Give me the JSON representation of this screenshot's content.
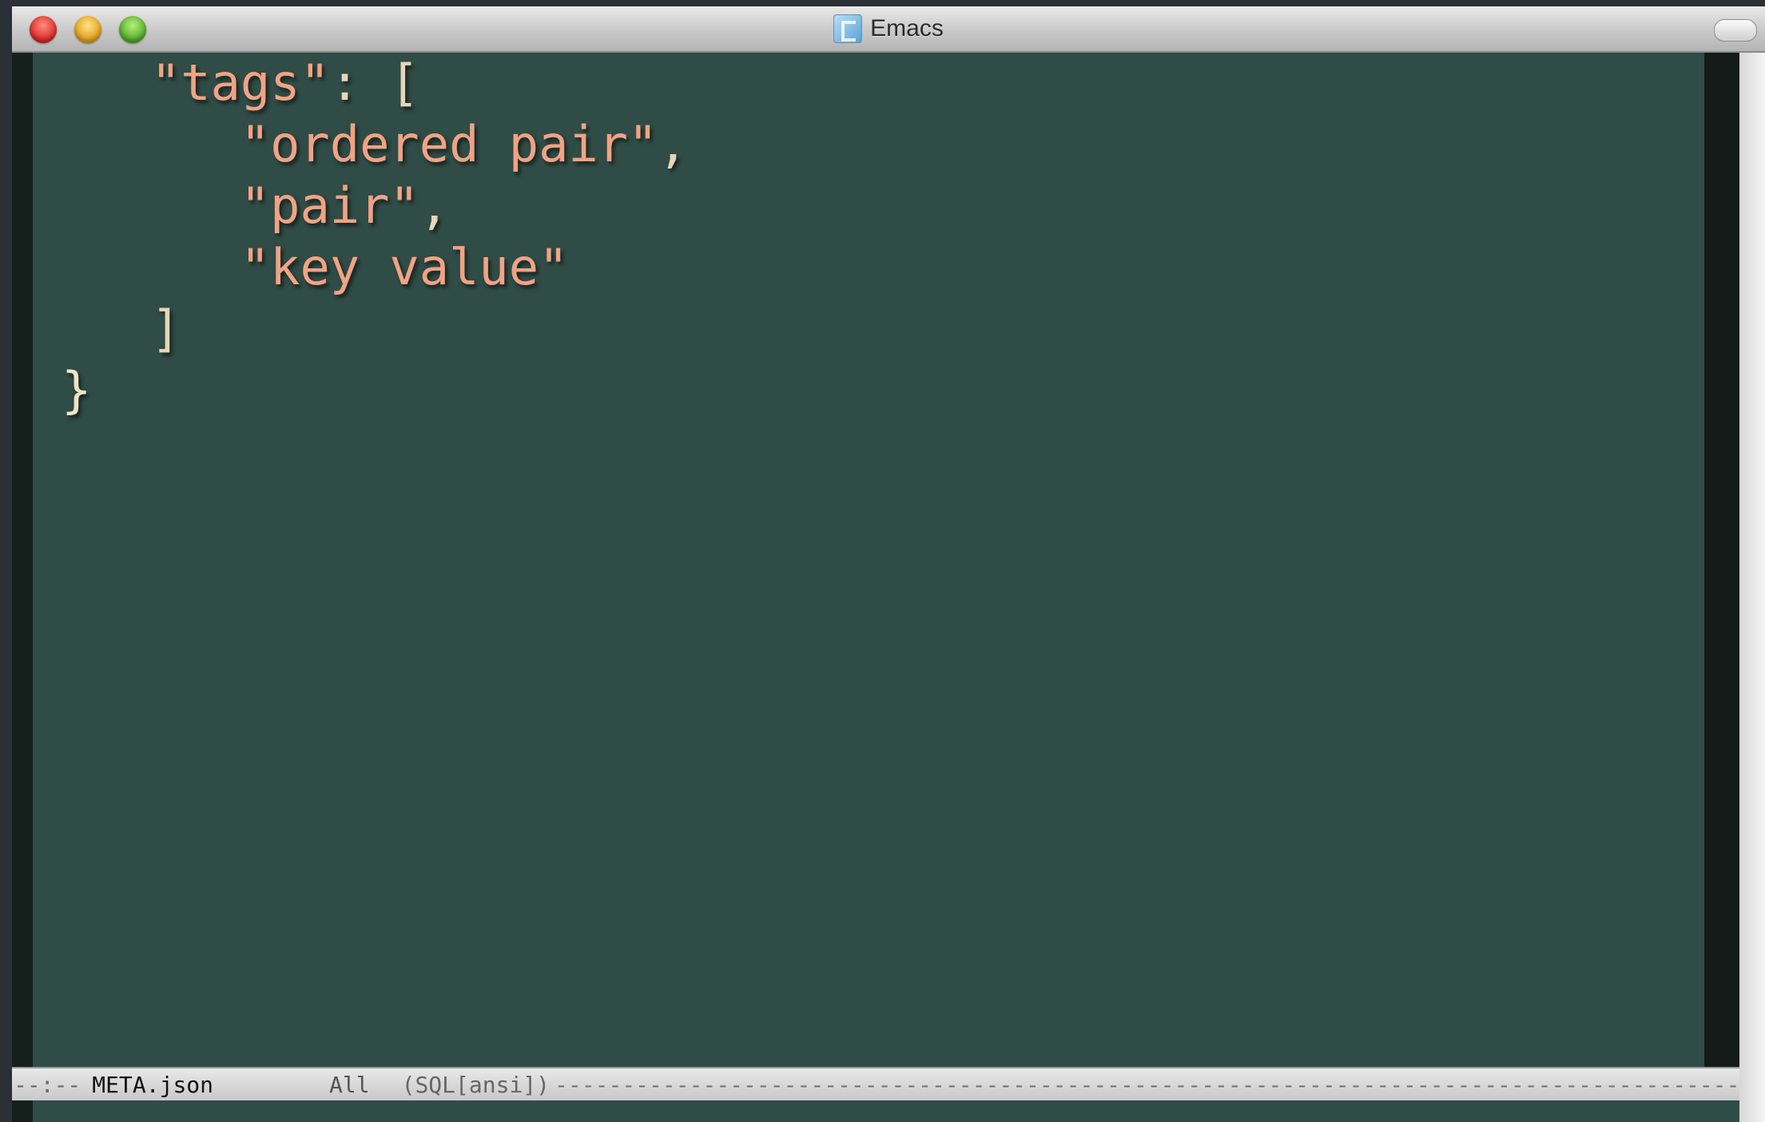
{
  "window": {
    "title": "Emacs"
  },
  "editor": {
    "lines": [
      {
        "indent": 3,
        "parts": [
          {
            "text": "\"tags\"",
            "kind": "string"
          },
          {
            "text": ": [",
            "kind": "punct"
          }
        ]
      },
      {
        "indent": 6,
        "parts": [
          {
            "text": "\"ordered pair\"",
            "kind": "string"
          },
          {
            "text": ",",
            "kind": "punct"
          }
        ]
      },
      {
        "indent": 6,
        "parts": [
          {
            "text": "\"pair\"",
            "kind": "string"
          },
          {
            "text": ",",
            "kind": "punct"
          }
        ]
      },
      {
        "indent": 6,
        "parts": [
          {
            "text": "\"key value\"",
            "kind": "string"
          }
        ]
      },
      {
        "indent": 3,
        "parts": [
          {
            "text": "]",
            "kind": "punct"
          }
        ]
      },
      {
        "indent": 0,
        "parts": [
          {
            "text": "}",
            "kind": "brace"
          }
        ]
      }
    ]
  },
  "modeline": {
    "status": "--:--",
    "buffer_name": "META.json",
    "position": "All",
    "mode": "(SQL[ansi])",
    "fill": "----------------------------------------------------------------------------------------------------------------"
  },
  "colors": {
    "editor_background": "#304c46",
    "string": "#f0a384",
    "punctuation": "#e7d6b8"
  },
  "icons": {
    "title_icon": "emacs-app-icon",
    "close": "close-icon",
    "minimize": "minimize-icon",
    "zoom": "zoom-icon",
    "toolbar_toggle": "toolbar-toggle-icon"
  }
}
